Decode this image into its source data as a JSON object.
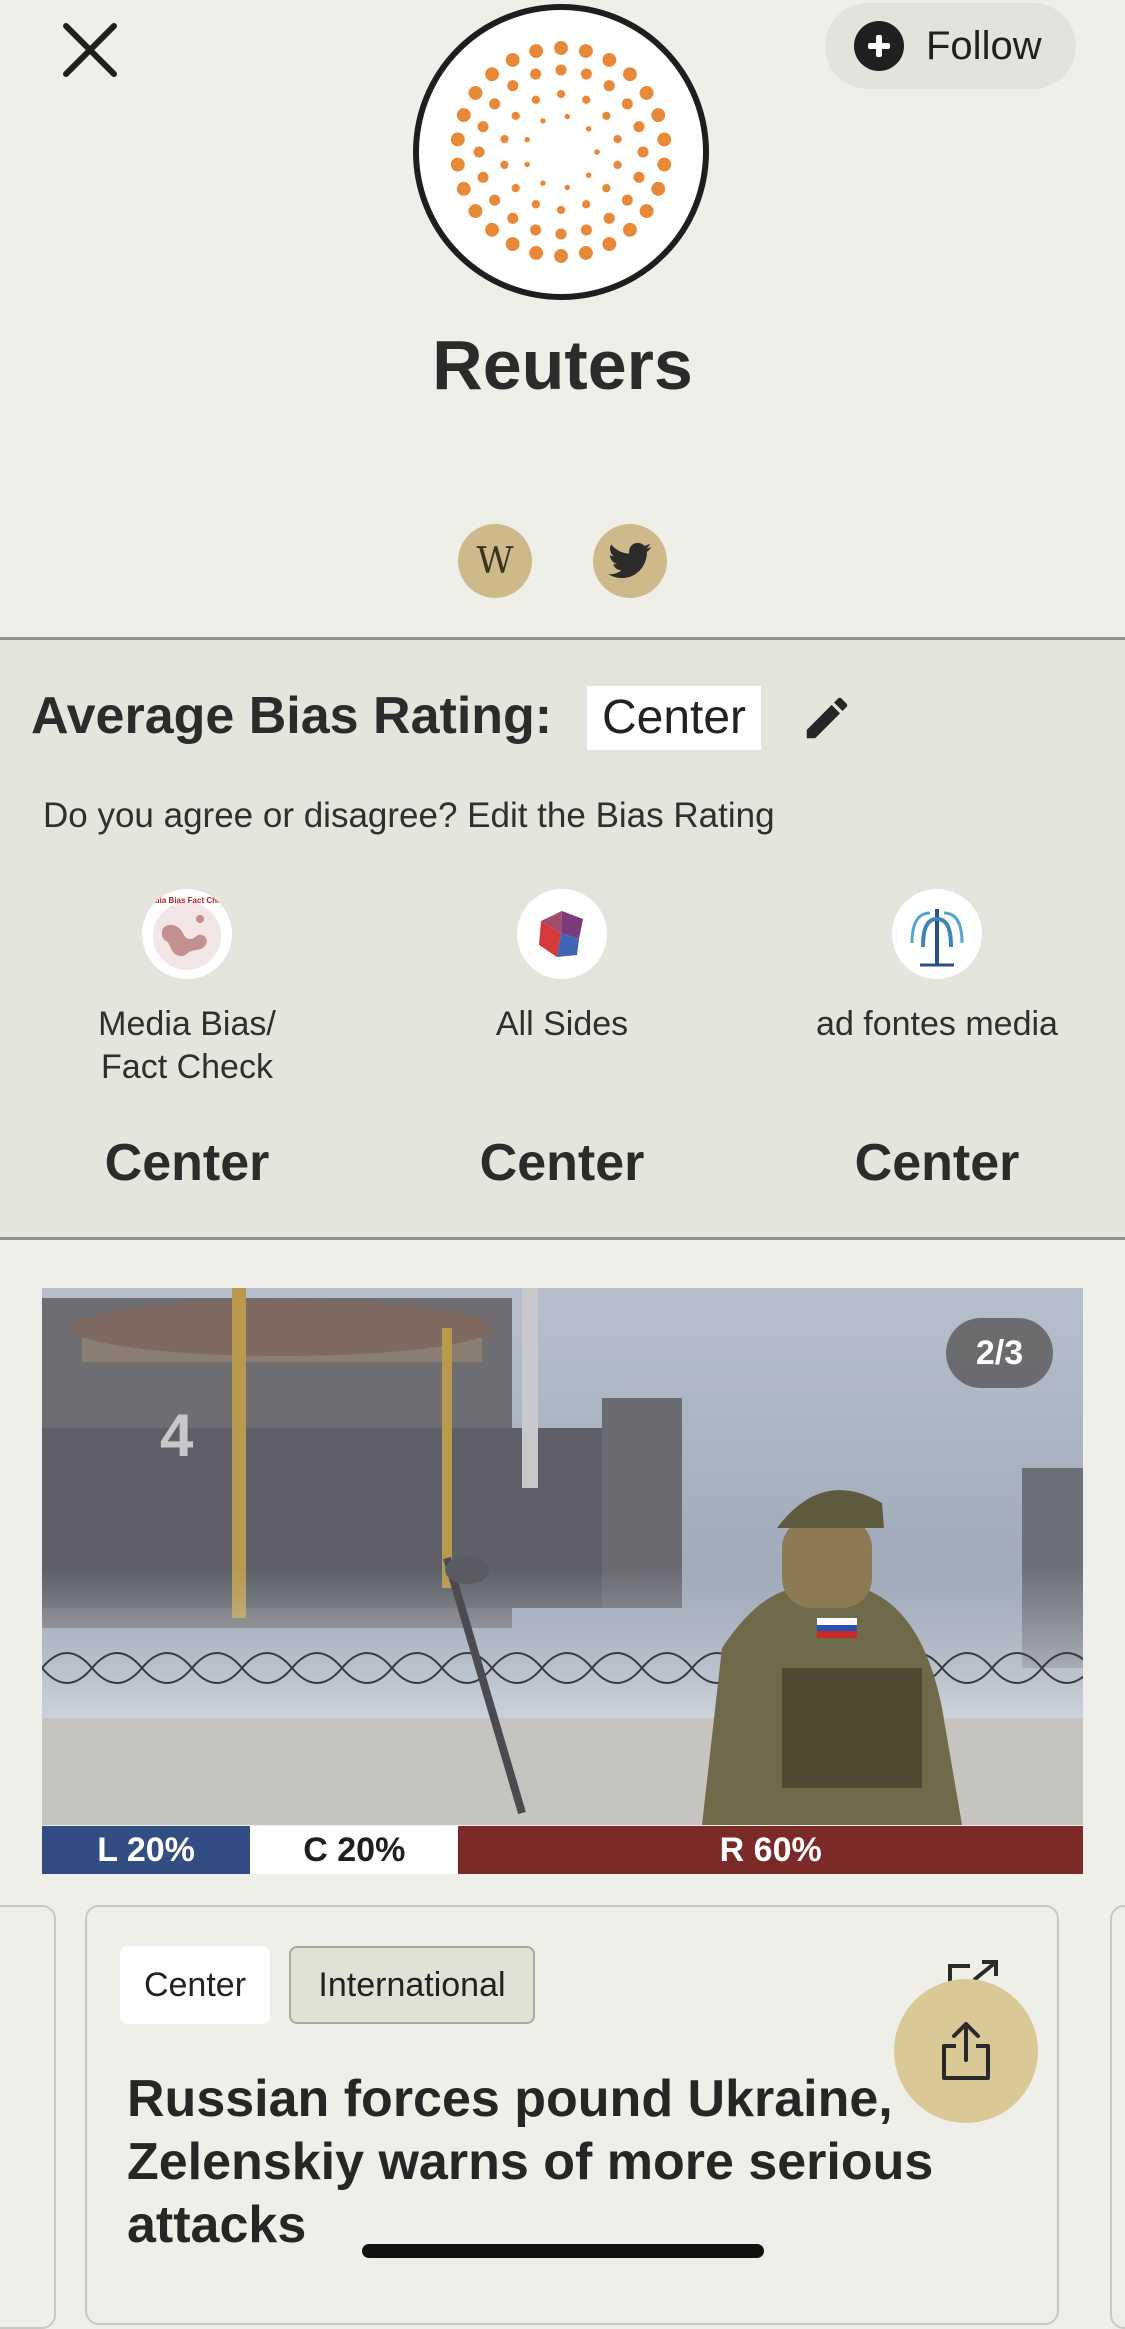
{
  "header": {
    "follow_label": "Follow",
    "source_name": "Reuters"
  },
  "social": {
    "wiki_label": "W"
  },
  "bias": {
    "average_label": "Average Bias Rating:",
    "average_value": "Center",
    "prompt": "Do you agree or disagree? Edit the Bias Rating",
    "raters": [
      {
        "name": "Media Bias/\nFact Check",
        "rating": "Center"
      },
      {
        "name": "All Sides",
        "rating": "Center"
      },
      {
        "name": "ad fontes media",
        "rating": "Center"
      }
    ]
  },
  "story": {
    "image_counter": "2/3",
    "coverage": {
      "left": "L 20%",
      "center": "C 20%",
      "right": "R 60%",
      "left_pct": 20,
      "center_pct": 20,
      "right_pct": 60
    },
    "tags": [
      "Center",
      "International"
    ],
    "headline": "Russian forces pound Ukraine, Zelenskiy warns of more serious attacks"
  },
  "colors": {
    "left_bar": "#324d82",
    "right_bar": "#7b2a28",
    "accent_gold": "#d9c996",
    "logo_orange": "#e8893a"
  },
  "icons": [
    "close-icon",
    "plus-icon",
    "wikipedia-icon",
    "twitter-icon",
    "pencil-icon",
    "external-link-icon",
    "share-icon"
  ]
}
